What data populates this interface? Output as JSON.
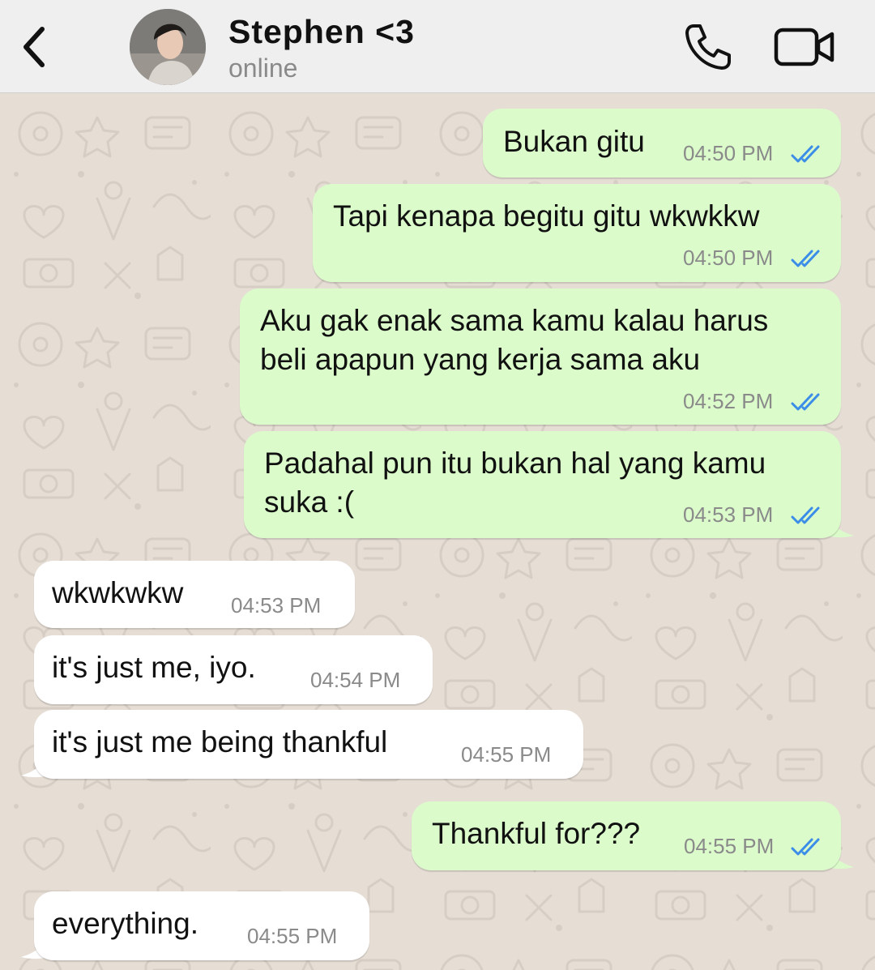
{
  "header": {
    "back_icon": "chevron-left-icon",
    "contact_name": "Stephen <3",
    "contact_status": "online",
    "call_icon": "phone-icon",
    "video_icon": "video-camera-icon"
  },
  "colors": {
    "header_bg": "#efefef",
    "chat_bg": "#e6ded5",
    "outgoing_bubble": "#dbfbcb",
    "incoming_bubble": "#ffffff",
    "read_ticks": "#3b8de8",
    "timestamp": "#8a8a8a"
  },
  "messages": [
    {
      "direction": "outgoing",
      "text": "Bukan gitu",
      "time": "04:50 PM",
      "status": "read"
    },
    {
      "direction": "outgoing",
      "text": "Tapi kenapa begitu gitu wkwkkw",
      "time": "04:50 PM",
      "status": "read"
    },
    {
      "direction": "outgoing",
      "text": "Aku gak enak sama kamu kalau harus\nbeli apapun yang kerja sama aku",
      "time": "04:52 PM",
      "status": "read"
    },
    {
      "direction": "outgoing",
      "text": "Padahal pun itu bukan hal yang kamu\nsuka :(",
      "time": "04:53 PM",
      "status": "read"
    },
    {
      "direction": "incoming",
      "text": "wkwkwkw",
      "time": "04:53 PM"
    },
    {
      "direction": "incoming",
      "text": "it's just me, iyo.",
      "time": "04:54 PM"
    },
    {
      "direction": "incoming",
      "text": "it's just me being thankful",
      "time": "04:55 PM"
    },
    {
      "direction": "outgoing",
      "text": "Thankful for???",
      "time": "04:55 PM",
      "status": "read"
    },
    {
      "direction": "incoming",
      "text": "everything.",
      "time": "04:55 PM"
    }
  ]
}
